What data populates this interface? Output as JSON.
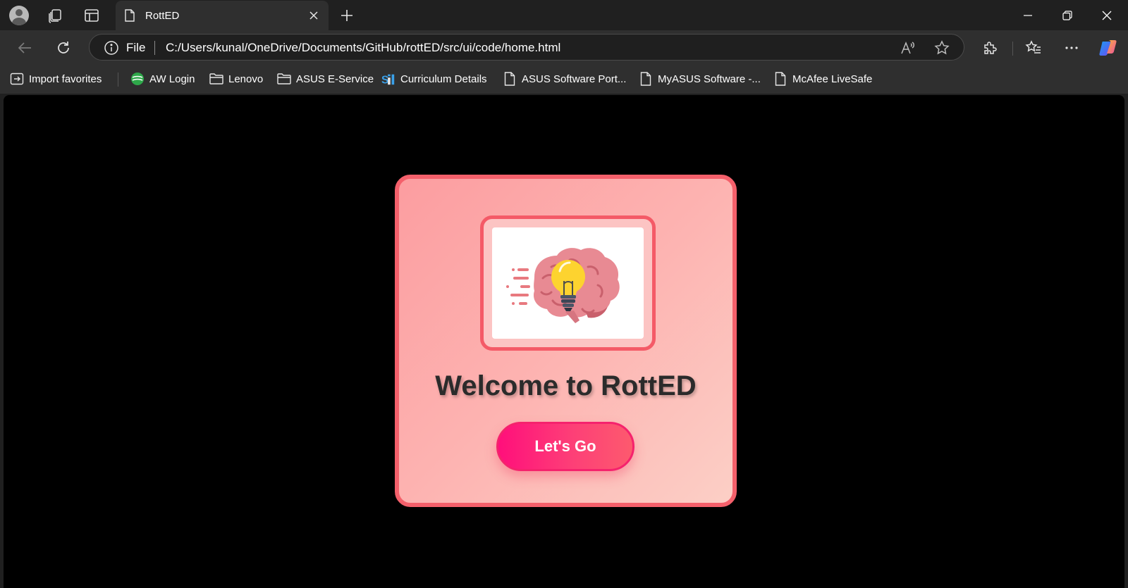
{
  "browser": {
    "tab": {
      "title": "RottED",
      "icon": "page-icon"
    },
    "window_controls": [
      "minimize-icon",
      "restore-icon",
      "close-icon"
    ],
    "address": {
      "scheme_label": "File",
      "url": "C:/Users/kunal/OneDrive/Documents/GitHub/rottED/src/ui/code/home.html"
    },
    "favorites_bar": [
      {
        "label": "Import favorites",
        "icon": "import-favorites-icon"
      },
      {
        "label": "AW Login",
        "icon": "aw-login-icon"
      },
      {
        "label": "Lenovo",
        "icon": "folder-icon"
      },
      {
        "label": "ASUS E-Service",
        "icon": "folder-icon"
      },
      {
        "label": "Curriculum Details",
        "icon": "sfi-icon"
      },
      {
        "label": "ASUS Software Port...",
        "icon": "page-icon"
      },
      {
        "label": "MyASUS Software -...",
        "icon": "page-icon"
      },
      {
        "label": "McAfee LiveSafe",
        "icon": "page-icon"
      }
    ]
  },
  "page": {
    "logo": {
      "icon": "brain-lightbulb-icon"
    },
    "welcome_text": "Welcome to RottED",
    "cta_label": "Let's Go"
  },
  "colors": {
    "card_border": "#f4606b",
    "card_gradient_start": "#fc9da0",
    "card_gradient_end": "#fccfc6",
    "button_gradient_start": "#ff0f7b",
    "button_gradient_end": "#fd5a6e",
    "page_background": "#000000"
  }
}
